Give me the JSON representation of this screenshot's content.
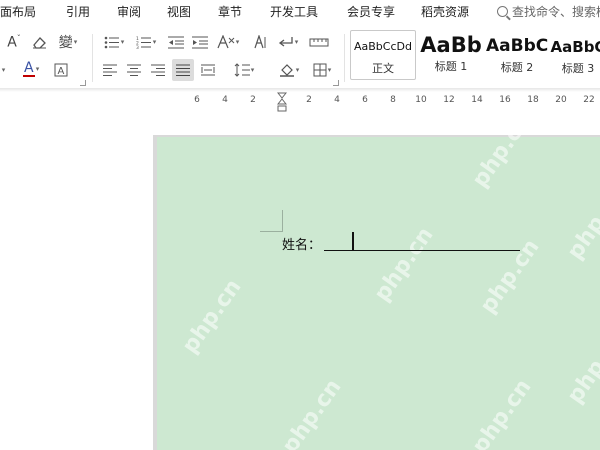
{
  "menubar": {
    "items": [
      "页面布局",
      "引用",
      "审阅",
      "视图",
      "章节",
      "开发工具",
      "会员专享",
      "稻壳资源"
    ],
    "search_placeholder": "查找命令、搜索模板"
  },
  "ribbon": {
    "font_color_accent": "#c00000",
    "styles": [
      {
        "sample": "AaBbCcDd",
        "name": "正文"
      },
      {
        "sample": "AaBb",
        "name": "标题 1"
      },
      {
        "sample": "AaBbC",
        "name": "标题 2"
      },
      {
        "sample": "AaBbC",
        "name": "标题 3"
      }
    ]
  },
  "ruler": {
    "ticks": [
      "6",
      "4",
      "2",
      "2",
      "4",
      "6",
      "8",
      "10",
      "12",
      "14",
      "16",
      "18",
      "20",
      "22"
    ]
  },
  "document": {
    "page_background": "#cde8d1",
    "field_label": "姓名：",
    "watermark": "php.cn"
  }
}
